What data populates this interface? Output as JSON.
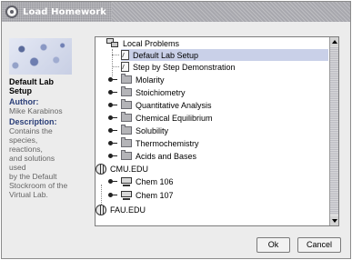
{
  "window": {
    "title": "Load Homework"
  },
  "info": {
    "title": "Default Lab Setup",
    "author_label": "Author:",
    "author": "Mike Karabinos",
    "description_label": "Description:",
    "description": [
      "Contains the",
      "species, reactions,",
      "and solutions used",
      "by the Default",
      "Stockroom of the",
      "Virtual Lab."
    ]
  },
  "tree": {
    "rows": [
      {
        "label": "Local Problems",
        "icon": "network-icon"
      },
      {
        "label": "Default Lab Setup",
        "icon": "document-icon",
        "selected": true
      },
      {
        "label": "Step by Step Demonstration",
        "icon": "document-icon"
      },
      {
        "label": "Molarity",
        "icon": "folder-icon"
      },
      {
        "label": "Stoichiometry",
        "icon": "folder-icon"
      },
      {
        "label": "Quantitative Analysis",
        "icon": "folder-icon"
      },
      {
        "label": "Chemical Equilibrium",
        "icon": "folder-icon"
      },
      {
        "label": "Solubility",
        "icon": "folder-icon"
      },
      {
        "label": "Thermochemistry",
        "icon": "folder-icon"
      },
      {
        "label": "Acids and Bases",
        "icon": "folder-icon"
      },
      {
        "label": "CMU.EDU",
        "icon": "world-icon"
      },
      {
        "label": "Chem 106",
        "icon": "monitor-icon"
      },
      {
        "label": "Chem 107",
        "icon": "monitor-icon"
      },
      {
        "label": "FAU.EDU",
        "icon": "world-icon"
      }
    ]
  },
  "buttons": {
    "ok": "Ok",
    "cancel": "Cancel"
  }
}
